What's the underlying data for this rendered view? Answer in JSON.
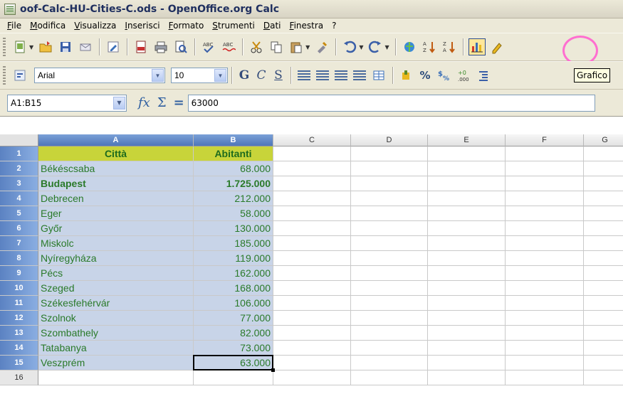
{
  "window": {
    "title": "oof-Calc-HU-Cities-C.ods - OpenOffice.org Calc"
  },
  "menu": [
    "File",
    "Modifica",
    "Visualizza",
    "Inserisci",
    "Formato",
    "Strumenti",
    "Dati",
    "Finestra",
    "?"
  ],
  "toolbar": {
    "font_name": "Arial",
    "font_size": "10",
    "bold_label": "G",
    "italic_label": "C",
    "underline_label": "S",
    "percent_label": "%",
    "tooltip": "Grafico"
  },
  "formula_bar": {
    "name_box": "A1:B15",
    "formula": "63000"
  },
  "columns": [
    "A",
    "B",
    "C",
    "D",
    "E",
    "F",
    "G"
  ],
  "rows": [
    "1",
    "2",
    "3",
    "4",
    "5",
    "6",
    "7",
    "8",
    "9",
    "10",
    "11",
    "12",
    "13",
    "14",
    "15",
    "16"
  ],
  "table": {
    "header": [
      "Città",
      "Abitanti"
    ],
    "data": [
      [
        "Békéscsaba",
        "68.000"
      ],
      [
        "Budapest",
        "1.725.000"
      ],
      [
        "Debrecen",
        "212.000"
      ],
      [
        "Eger",
        "58.000"
      ],
      [
        "Győr",
        "130.000"
      ],
      [
        "Miskolc",
        "185.000"
      ],
      [
        "Nyíregyháza",
        "119.000"
      ],
      [
        "Pécs",
        "162.000"
      ],
      [
        "Szeged",
        "168.000"
      ],
      [
        "Székesfehérvár",
        "106.000"
      ],
      [
        "Szolnok",
        "77.000"
      ],
      [
        "Szombathely",
        "82.000"
      ],
      [
        "Tatabanya",
        "73.000"
      ],
      [
        "Veszprém",
        "63.000"
      ]
    ]
  },
  "colors": {
    "highlight_circle": "#ff6fd0",
    "header_fill": "#c8d43a",
    "selection": "#c8d4e8"
  }
}
